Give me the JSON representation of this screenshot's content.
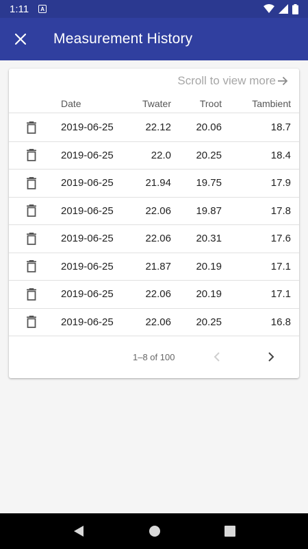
{
  "status": {
    "time": "1:11"
  },
  "appbar": {
    "title": "Measurement History"
  },
  "card": {
    "scroll_hint": "Scroll to view more",
    "headers": {
      "date": "Date",
      "twater": "Twater",
      "troot": "Troot",
      "tambient": "Tambient"
    },
    "rows": [
      {
        "date": "2019-06-25",
        "twater": "22.12",
        "troot": "20.06",
        "tambient": "18.7"
      },
      {
        "date": "2019-06-25",
        "twater": "22.0",
        "troot": "20.25",
        "tambient": "18.4"
      },
      {
        "date": "2019-06-25",
        "twater": "21.94",
        "troot": "19.75",
        "tambient": "17.9"
      },
      {
        "date": "2019-06-25",
        "twater": "22.06",
        "troot": "19.87",
        "tambient": "17.8"
      },
      {
        "date": "2019-06-25",
        "twater": "22.06",
        "troot": "20.31",
        "tambient": "17.6"
      },
      {
        "date": "2019-06-25",
        "twater": "21.87",
        "troot": "20.19",
        "tambient": "17.1"
      },
      {
        "date": "2019-06-25",
        "twater": "22.06",
        "troot": "20.19",
        "tambient": "17.1"
      },
      {
        "date": "2019-06-25",
        "twater": "22.06",
        "troot": "20.25",
        "tambient": "16.8"
      }
    ],
    "pagination": {
      "range": "1–8 of 100"
    }
  },
  "colors": {
    "statusbar": "#2b3990",
    "appbar": "#303f9f"
  }
}
